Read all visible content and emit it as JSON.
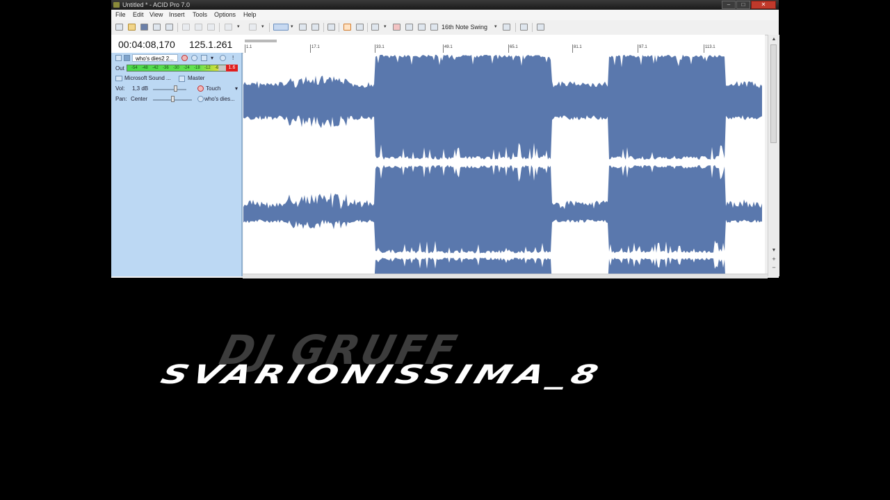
{
  "window": {
    "title": "Untitled * - ACID Pro 7.0",
    "controls": [
      "–",
      "□",
      "✕"
    ]
  },
  "menu": [
    "File",
    "Edit",
    "View",
    "Insert",
    "Tools",
    "Options",
    "Help"
  ],
  "toolbar": {
    "swing_label": "16th Note Swing"
  },
  "transport": {
    "time": "00:04:08,170",
    "position": "125.1.261"
  },
  "track": {
    "name": "who's dies2 2...",
    "out_label": "Out",
    "meter_ticks": [
      "-54",
      "-48",
      "-42",
      "-36",
      "-30",
      "-24",
      "-18",
      "-12",
      "-6"
    ],
    "peak": "1.6",
    "device": "Microsoft Sound ...",
    "bus": "Master",
    "vol_label": "Vol:",
    "vol_value": "1,3 dB",
    "vol_level": 0.7,
    "automation_mode": "Touch",
    "pan_label": "Pan:",
    "pan_value": "Center",
    "pan_level": 0.5,
    "fx_chain": "who's dies..."
  },
  "ruler": {
    "markers": [
      "1.1",
      "17.1",
      "33.1",
      "49.1",
      "65.1",
      "81.1",
      "97.1",
      "113.1"
    ]
  },
  "overlay": {
    "watermark": "DJ GRUFF",
    "title": "SVARIONISSIMA_8"
  },
  "colors": {
    "waveform_fill": "#5a78ad",
    "waveform_peak": "#ffffff",
    "track_header": "#bcd8f3",
    "meter_green": "#49d84a",
    "peak_red": "#e01e1e",
    "background": "#000000"
  }
}
